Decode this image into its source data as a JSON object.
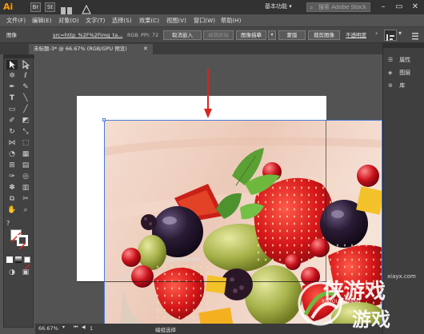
{
  "titlebar": {
    "logo": "Ai",
    "btn_br": "Br",
    "btn_st": "St",
    "workspace": "基本功能 ▾",
    "stock_placeholder": "搜索 Adobe Stock",
    "minimize": "–",
    "restore": "▭",
    "close": "✕"
  },
  "menu": [
    "文件(F)",
    "编辑(E)",
    "对象(O)",
    "文字(T)",
    "选择(S)",
    "效果(C)",
    "视图(V)",
    "窗口(W)",
    "帮助(H)"
  ],
  "control": {
    "type_label": "图像",
    "link_text": "src=http_%2F%2Fimg_ta...",
    "colormode": "RGB",
    "ppi": "PPI: 72",
    "embed": "取消嵌入",
    "edit_original": "编辑原稿",
    "image_trace": "图像描摹",
    "mask": "蒙版",
    "crop": "裁剪图像",
    "opacity": "不透明度"
  },
  "doc_tab": "未标题-3* @ 66.67% (RGB/GPU 预览)",
  "doc_tab_close": "✕",
  "panels": [
    {
      "icon": "properties-icon",
      "label": "属性"
    },
    {
      "icon": "layers-icon",
      "label": "图层"
    },
    {
      "icon": "library-icon",
      "label": "库"
    }
  ],
  "status": {
    "zoom": "66.67%",
    "artboard": "1",
    "selection": "编组选择"
  },
  "watermark": {
    "site": "xiayx.com",
    "brand_top": "侠游戏",
    "brand_sub": "XIAYOUXI.WANG",
    "brand_bottom": "游戏"
  },
  "colors": {
    "accent_arrow": "#d9251c",
    "selection": "#4a7ad8",
    "logo": "#ff9a00"
  }
}
